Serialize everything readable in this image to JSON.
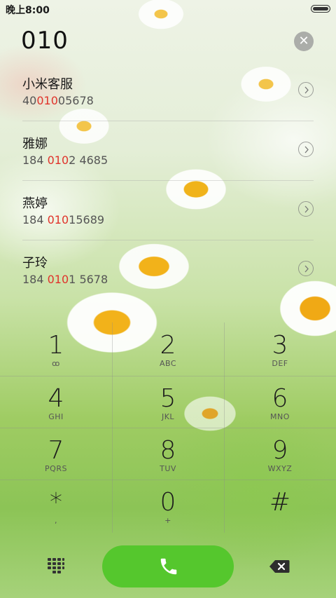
{
  "status_bar": {
    "time": "晚上8:00"
  },
  "dial_number": "010",
  "clear_icon": "close-icon",
  "contacts": [
    {
      "name": "小米客服",
      "number_pre": "40",
      "number_match": "010",
      "number_post": "05678"
    },
    {
      "name": "雅娜",
      "number_pre": "184 ",
      "number_match": "010",
      "number_post": "2 4685"
    },
    {
      "name": "燕婷",
      "number_pre": "184 ",
      "number_match": "010",
      "number_post": "15689"
    },
    {
      "name": "子玲",
      "number_pre": "184 ",
      "number_match": "010",
      "number_post": "1 5678"
    }
  ],
  "keys": [
    {
      "digit": "1",
      "letters": "ꝏ"
    },
    {
      "digit": "2",
      "letters": "ABC"
    },
    {
      "digit": "3",
      "letters": "DEF"
    },
    {
      "digit": "4",
      "letters": "GHI"
    },
    {
      "digit": "5",
      "letters": "JKL"
    },
    {
      "digit": "6",
      "letters": "MNO"
    },
    {
      "digit": "7",
      "letters": "PQRS"
    },
    {
      "digit": "8",
      "letters": "TUV"
    },
    {
      "digit": "9",
      "letters": "WXYZ"
    },
    {
      "digit": "*",
      "letters": ","
    },
    {
      "digit": "0",
      "letters": "+"
    },
    {
      "digit": "#",
      "letters": ""
    }
  ],
  "colors": {
    "call_button": "#55c72d",
    "match_highlight": "#e0332b"
  },
  "icons": {
    "call": "phone-icon",
    "keypad": "keypad-icon",
    "delete": "backspace-icon",
    "detail": "chevron-right-icon"
  }
}
